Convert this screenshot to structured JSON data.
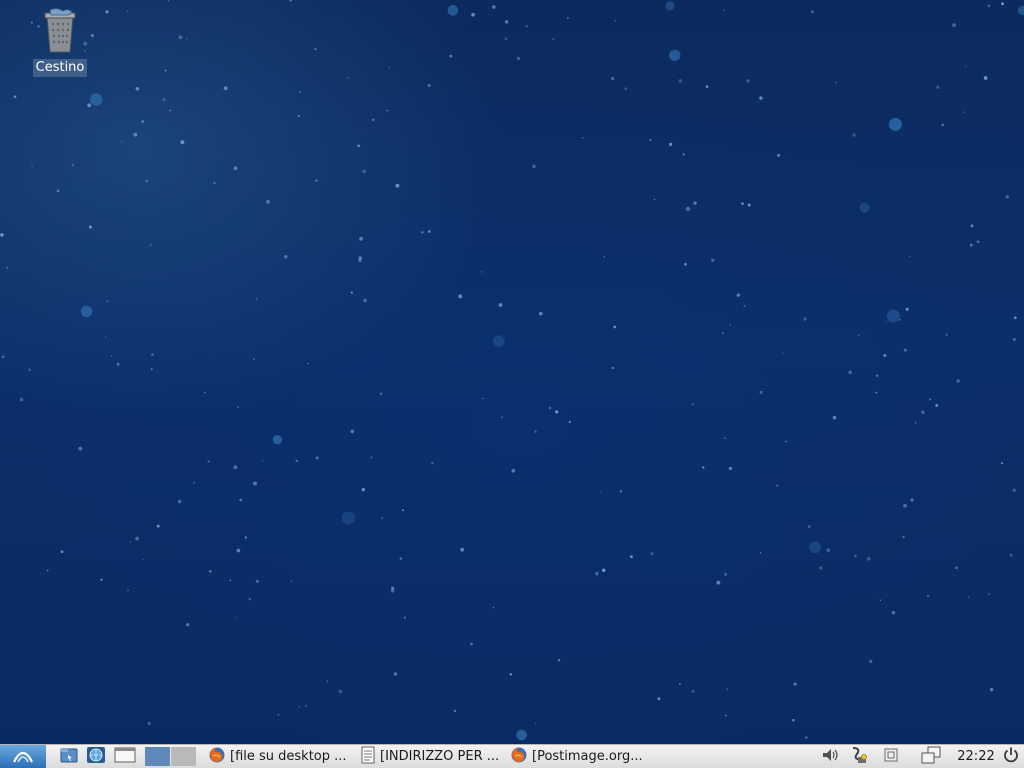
{
  "desktop": {
    "icons": [
      {
        "label": "Cestino",
        "icon": "trash-bin-icon"
      }
    ]
  },
  "taskbar": {
    "menu_icon": "start-menu-icon",
    "launchers": [
      "file-manager-icon",
      "browser-icon",
      "show-desktop-icon"
    ],
    "pager": {
      "desktops": 2,
      "active": 1
    },
    "tasks": [
      {
        "label": "[file su desktop ...",
        "icon": "firefox-icon"
      },
      {
        "label": "[INDIRIZZO PER ...",
        "icon": "text-editor-icon"
      },
      {
        "label": "[Postimage.org...",
        "icon": "firefox-icon"
      }
    ],
    "tray": [
      "volume-icon",
      "network-icon",
      "clipboard-icon",
      "window-switch-icon"
    ],
    "clock": "22:22",
    "power_icon": "power-icon"
  },
  "colors": {
    "desktop_bg": "#0b2f6b",
    "taskbar_bg": "#dcdcdc",
    "selection_label": "#3f5f88"
  }
}
